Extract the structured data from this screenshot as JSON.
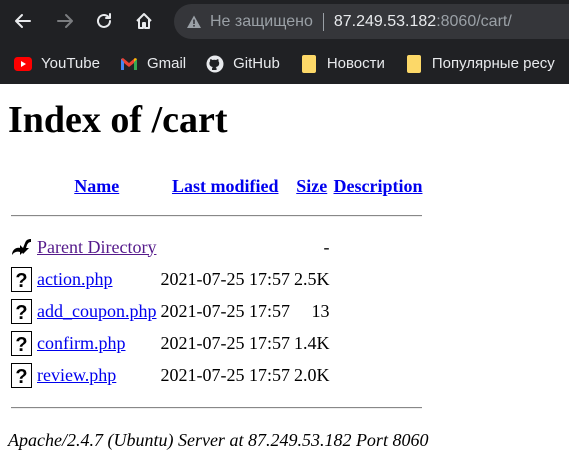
{
  "browser": {
    "omnibox": {
      "security_text": "Не защищено",
      "url_host": "87.249.53.182",
      "url_rest": ":8060/cart/"
    },
    "bookmarks": [
      {
        "label": "YouTube",
        "icon": "youtube-icon"
      },
      {
        "label": "Gmail",
        "icon": "gmail-icon"
      },
      {
        "label": "GitHub",
        "icon": "github-icon"
      },
      {
        "label": "Новости",
        "icon": "folder-icon"
      },
      {
        "label": "Популярные ресу",
        "icon": "folder-icon"
      }
    ]
  },
  "page": {
    "title": "Index of /cart",
    "columns": {
      "name": "Name",
      "last_modified": "Last modified",
      "size": "Size",
      "description": "Description"
    },
    "parent": {
      "label": "Parent Directory",
      "size": "-"
    },
    "files": [
      {
        "name": "action.php",
        "modified": "2021-07-25 17:57",
        "size": "2.5K"
      },
      {
        "name": "add_coupon.php",
        "modified": "2021-07-25 17:57",
        "size": "13"
      },
      {
        "name": "confirm.php",
        "modified": "2021-07-25 17:57",
        "size": "1.4K"
      },
      {
        "name": "review.php",
        "modified": "2021-07-25 17:57",
        "size": "2.0K"
      }
    ],
    "address": "Apache/2.4.7 (Ubuntu) Server at 87.249.53.182 Port 8060"
  }
}
